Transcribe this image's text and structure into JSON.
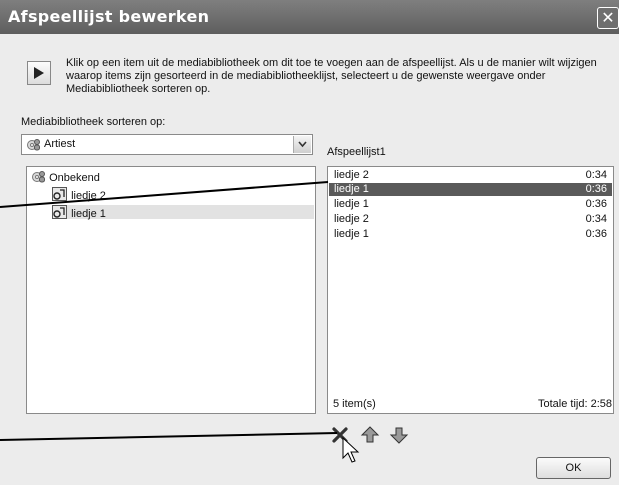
{
  "window": {
    "title": "Afspeellijst bewerken",
    "close_glyph": "✕"
  },
  "instructions": "Klik op een item uit de mediabibliotheek om dit toe te voegen aan de afspeellijst. Als u de manier wilt wijzigen waarop items zijn gesorteerd in de mediabibliotheeklijst, selecteert u de gewenste weergave onder Mediabibliotheek sorteren op.",
  "sort": {
    "label": "Mediabibliotheek sorteren op:",
    "selected": "Artiest",
    "icon": "artist-icon"
  },
  "library": {
    "root": "Onbekend",
    "items": [
      "liedje 2",
      "liedje 1"
    ],
    "selected_index": 1
  },
  "playlist": {
    "title": "Afspeellijst1",
    "rows": [
      {
        "name": "liedje 2",
        "duration": "0:34"
      },
      {
        "name": "liedje 1",
        "duration": "0:36"
      },
      {
        "name": "liedje 1",
        "duration": "0:36"
      },
      {
        "name": "liedje 2",
        "duration": "0:34"
      },
      {
        "name": "liedje 1",
        "duration": "0:36"
      }
    ],
    "selected_index": 1,
    "count": "5 item(s)",
    "total": "Totale tijd: 2:58"
  },
  "toolbar": {
    "remove_icon": "delete-x-icon",
    "up_icon": "move-up-icon",
    "down_icon": "move-down-icon"
  },
  "ok_label": "OK",
  "colors": {
    "titlebar": "#6b6b6b",
    "selection": "#5a5a5a",
    "background": "#ececec"
  }
}
